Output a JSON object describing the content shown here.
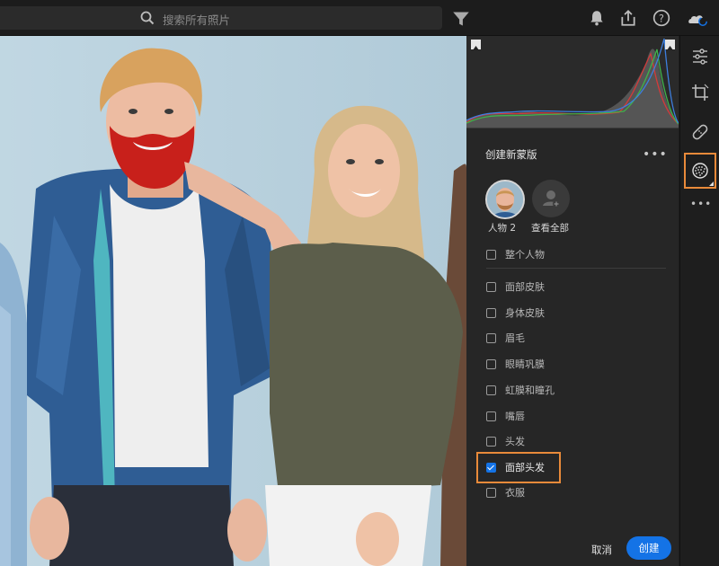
{
  "topbar": {
    "search_placeholder": "搜索所有照片",
    "icons": [
      "search-icon",
      "filter-icon",
      "bell-icon",
      "share-icon",
      "help-icon",
      "cloud-sync-icon"
    ]
  },
  "panel": {
    "title": "创建新蒙版",
    "more": "•••",
    "people": [
      {
        "label": "人物 2"
      },
      {
        "label": "查看全部"
      }
    ],
    "whole_person": "整个人物",
    "options": [
      {
        "label": "面部皮肤",
        "checked": false
      },
      {
        "label": "身体皮肤",
        "checked": false
      },
      {
        "label": "眉毛",
        "checked": false
      },
      {
        "label": "眼睛巩膜",
        "checked": false
      },
      {
        "label": "虹膜和瞳孔",
        "checked": false
      },
      {
        "label": "嘴唇",
        "checked": false
      },
      {
        "label": "头发",
        "checked": false
      },
      {
        "label": "面部头发",
        "checked": true
      },
      {
        "label": "衣服",
        "checked": false
      }
    ],
    "cancel_label": "取消",
    "create_label": "创建"
  },
  "rail": {
    "icons": [
      "edit-sliders-icon",
      "crop-icon",
      "healing-icon",
      "masking-icon",
      "more-icon"
    ],
    "more": "•••"
  },
  "colors": {
    "accent": "#1473e6",
    "highlight": "#e98a3a"
  }
}
